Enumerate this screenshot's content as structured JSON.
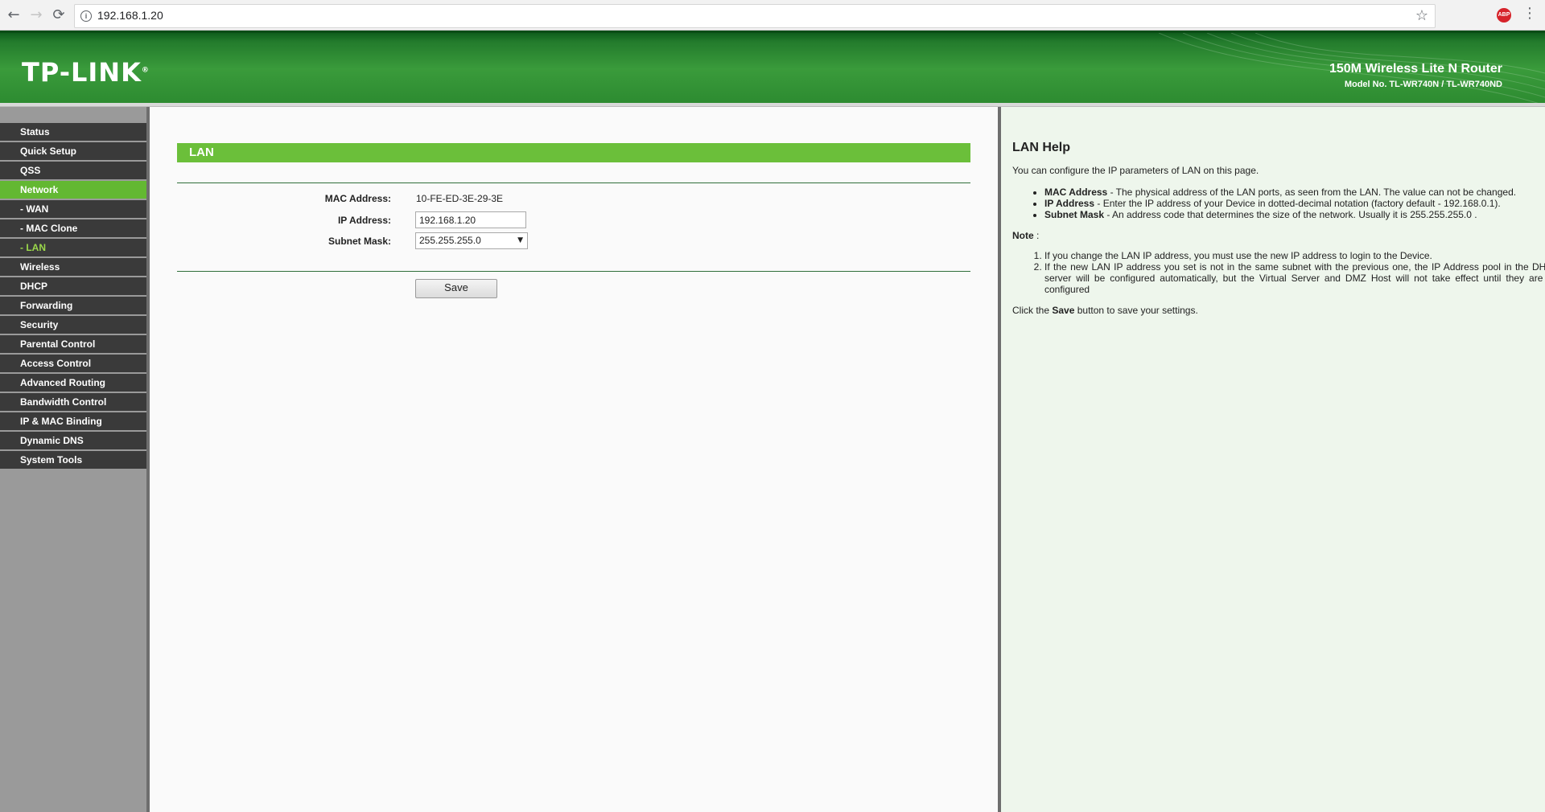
{
  "browser": {
    "url": "192.168.1.20",
    "abp_label": "ABP"
  },
  "header": {
    "logo": "TP-LINK",
    "logo_mark": "®",
    "product_title": "150M Wireless Lite N Router",
    "model_no": "Model No. TL-WR740N / TL-WR740ND"
  },
  "sidebar": {
    "items": [
      {
        "label": "Status"
      },
      {
        "label": "Quick Setup"
      },
      {
        "label": "QSS"
      },
      {
        "label": "Network"
      },
      {
        "label": "- WAN"
      },
      {
        "label": "- MAC Clone"
      },
      {
        "label": "- LAN"
      },
      {
        "label": "Wireless"
      },
      {
        "label": "DHCP"
      },
      {
        "label": "Forwarding"
      },
      {
        "label": "Security"
      },
      {
        "label": "Parental Control"
      },
      {
        "label": "Access Control"
      },
      {
        "label": "Advanced Routing"
      },
      {
        "label": "Bandwidth Control"
      },
      {
        "label": "IP & MAC Binding"
      },
      {
        "label": "Dynamic DNS"
      },
      {
        "label": "System Tools"
      }
    ],
    "active_item": "Network",
    "active_subitem": "- LAN"
  },
  "main": {
    "section_title": "LAN",
    "mac_label": "MAC Address:",
    "mac_value": "10-FE-ED-3E-29-3E",
    "ip_label": "IP Address:",
    "ip_value": "192.168.1.20",
    "mask_label": "Subnet Mask:",
    "mask_value": "255.255.255.0",
    "save_label": "Save"
  },
  "help": {
    "title": "LAN Help",
    "intro": "You can configure the IP parameters of LAN on this page.",
    "bullets": [
      {
        "term": "MAC Address",
        "text": " - The physical address of the LAN ports, as seen from the LAN. The value can not be changed."
      },
      {
        "term": "IP Address",
        "text": " - Enter the IP address of your Device in dotted-decimal notation (factory default - 192.168.0.1)."
      },
      {
        "term": "Subnet Mask",
        "text": " - An address code that determines the size of the network. Usually it is 255.255.255.0 ."
      }
    ],
    "note_label": "Note",
    "note_colon": ":",
    "notes": [
      "If you change the LAN IP address, you must use the new IP address to login to the Device.",
      "If the new LAN IP address you set is not in the same subnet with the previous one, the IP Address pool in the DHCP server will be configured automatically, but the Virtual Server and DMZ Host will not take effect until they are re-configured"
    ],
    "save_line_prefix": "Click the ",
    "save_line_bold": "Save",
    "save_line_suffix": " button to save your settings."
  }
}
